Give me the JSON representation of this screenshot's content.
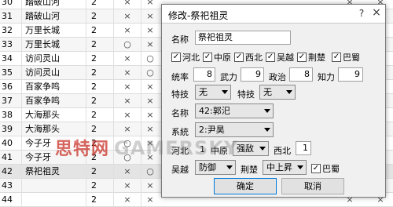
{
  "table": {
    "rows": [
      {
        "id": "30",
        "name": "踏破山河",
        "num": "2",
        "a": "×",
        "b": "×",
        "r1": "×",
        "r2": "×"
      },
      {
        "id": "31",
        "name": "踏破山河",
        "num": "2",
        "a": "×",
        "b": "×",
        "r1": "×",
        "r2": "○"
      },
      {
        "id": "32",
        "name": "万里长城",
        "num": "2",
        "a": "×",
        "b": "×",
        "r1": "×",
        "r2": "×"
      },
      {
        "id": "33",
        "name": "万里长城",
        "num": "2",
        "a": "○",
        "b": "×",
        "r1": "○",
        "r2": "×"
      },
      {
        "id": "34",
        "name": "访问灵山",
        "num": "2",
        "a": "×",
        "b": "○",
        "r1": "×",
        "r2": "○"
      },
      {
        "id": "35",
        "name": "访问灵山",
        "num": "2",
        "a": "×",
        "b": "○",
        "r1": "×",
        "r2": "○"
      },
      {
        "id": "36",
        "name": "百家争鸣",
        "num": "2",
        "a": "×",
        "b": "×",
        "r1": "×",
        "r2": "×"
      },
      {
        "id": "37",
        "name": "百家争鸣",
        "num": "2",
        "a": "×",
        "b": "×",
        "r1": "×",
        "r2": "×"
      },
      {
        "id": "38",
        "name": "大海那头",
        "num": "2",
        "a": "×",
        "b": "×",
        "r1": "○",
        "r2": "×"
      },
      {
        "id": "39",
        "name": "大海那头",
        "num": "2",
        "a": "×",
        "b": "×",
        "r1": "×",
        "r2": "×"
      },
      {
        "id": "40",
        "name": "今子牙",
        "num": "2",
        "a": "○",
        "b": "×",
        "r1": "×",
        "r2": "×"
      },
      {
        "id": "41",
        "name": "今子牙",
        "num": "2",
        "a": "○",
        "b": "×",
        "r1": "×",
        "r2": "×"
      },
      {
        "id": "42",
        "name": "祭祀祖灵",
        "num": "2",
        "a": "×",
        "b": "○",
        "r1": "×",
        "r2": "×"
      },
      {
        "id": "43",
        "name": "",
        "num": "2",
        "a": "×",
        "b": "×",
        "r1": "×",
        "r2": "×"
      },
      {
        "id": "44",
        "name": "",
        "num": "2",
        "a": "×",
        "b": "×",
        "r1": "×",
        "r2": "×"
      }
    ]
  },
  "dialog": {
    "title": "修改-祭祀祖灵",
    "help": "?",
    "close": "×",
    "name_label": "名称",
    "name_value": "祭祀祖灵",
    "regions": [
      {
        "label": "河北",
        "checked": true
      },
      {
        "label": "中原",
        "checked": true
      },
      {
        "label": "西北",
        "checked": true
      },
      {
        "label": "吴越",
        "checked": true
      },
      {
        "label": "荆楚",
        "checked": true
      },
      {
        "label": "巴蜀",
        "checked": true
      }
    ],
    "stats": {
      "lead_label": "统率",
      "lead_value": "8",
      "war_label": "武力",
      "war_value": "9",
      "pol_label": "政治",
      "pol_value": "8",
      "int_label": "知力",
      "int_value": "9"
    },
    "skill_label": "特技",
    "skill1_value": "无",
    "skill2_label": "特技",
    "skill2_value": "无",
    "name2_label": "名称",
    "name2_value": "42:郭汜",
    "system_label": "系統",
    "system_value": "2:尹昊",
    "hebei_label": "河北",
    "hebei_value": "1",
    "zhongyuan_label": "中原",
    "zhongyuan_value": "强敌",
    "xibei_label": "西北",
    "xibei_value": "1",
    "wuyue_label": "吴越",
    "wuyue_value": "防御",
    "jingchu_label": "荆楚",
    "jingchu_value": "中上昇",
    "bashu_label": "巴蜀",
    "bashu_checked": true,
    "ok_label": "确定",
    "cancel_label": "取消"
  },
  "watermark": {
    "cn": "思特网",
    "en": "GAMERSKY"
  },
  "colors": {
    "dialog_bg": "#f0f0f0",
    "accent": "#0078d7",
    "watermark": "#c83228"
  }
}
